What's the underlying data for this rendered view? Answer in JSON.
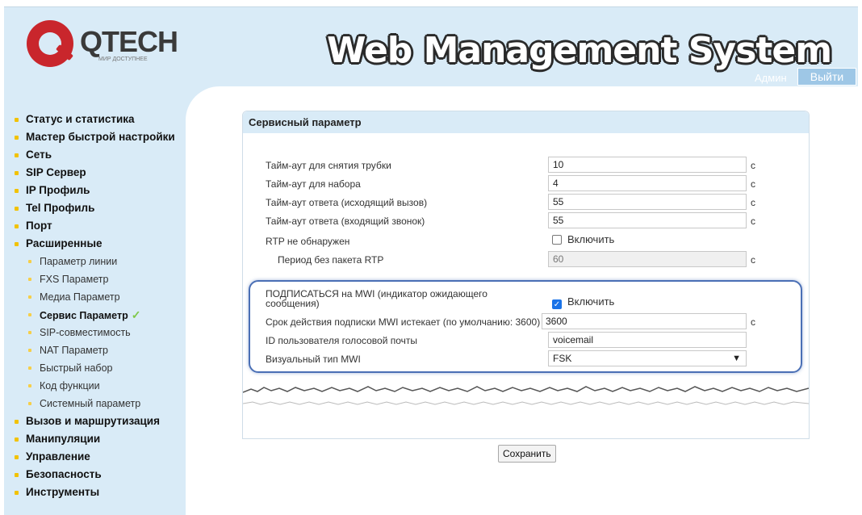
{
  "header": {
    "logo_text": "QTECH",
    "logo_sub": "МИР ДОСТУПНЕЕ",
    "title": "Web Management System",
    "user": "Админ",
    "logout_label": "Выйти"
  },
  "sidebar": {
    "items": [
      {
        "label": "Статус и статистика"
      },
      {
        "label": "Мастер быстрой настройки"
      },
      {
        "label": "Сеть"
      },
      {
        "label": "SIP Сервер"
      },
      {
        "label": "IP Профиль"
      },
      {
        "label": "Tel Профиль"
      },
      {
        "label": "Порт"
      },
      {
        "label": "Расширенные"
      }
    ],
    "sub_items": [
      {
        "label": "Параметр линии"
      },
      {
        "label": "FXS Параметр"
      },
      {
        "label": "Медиа Параметр"
      },
      {
        "label": "Сервис Параметр"
      },
      {
        "label": "SIP-совместимость"
      },
      {
        "label": "NAT Параметр"
      },
      {
        "label": "Быстрый набор"
      },
      {
        "label": "Код функции"
      },
      {
        "label": "Системный параметр"
      }
    ],
    "items_after": [
      {
        "label": "Вызов и маршрутизация"
      },
      {
        "label": "Манипуляции"
      },
      {
        "label": "Управление"
      },
      {
        "label": "Безопасность"
      },
      {
        "label": "Инструменты"
      }
    ],
    "active_mark": "✓"
  },
  "panel": {
    "title": "Сервисный параметр",
    "offhook_label": "Тайм-аут для снятия трубки",
    "offhook_value": "10",
    "dial_label": "Тайм-аут для набора",
    "dial_value": "4",
    "answer_out_label": "Тайм-аут ответа (исходящий вызов)",
    "answer_out_value": "55",
    "answer_in_label": "Тайм-аут ответа (входящий звонок)",
    "answer_in_value": "55",
    "rtp_label": "RTP не обнаружен",
    "rtp_enable": "Включить",
    "rtp_period_label": "Период без пакета RTP",
    "rtp_period_value": "60",
    "mwi_sub_label_1": "ПОДПИСАТЬСЯ на MWI (индикатор ожидающего",
    "mwi_sub_label_2": "сообщения)",
    "mwi_enable": "Включить",
    "mwi_expire_label": "Срок действия подписки MWI истекает (по умолчанию: 3600)",
    "mwi_expire_value": "3600",
    "voicemail_label": "ID пользователя голосовой почты",
    "voicemail_value": "voicemail",
    "mwi_type_label": "Визуальный тип MWI",
    "mwi_type_value": "FSK",
    "unit": "с"
  },
  "save_label": "Сохранить"
}
